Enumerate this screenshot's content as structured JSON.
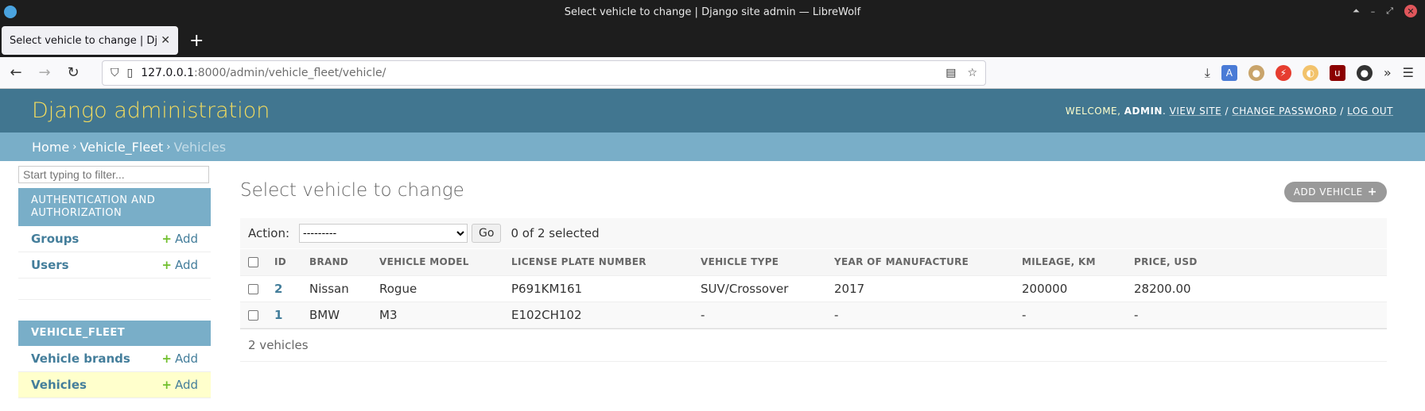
{
  "browser": {
    "window_title": "Select vehicle to change | Django site admin — LibreWolf",
    "tab_title": "Select vehicle to change | Django site admin",
    "url_host": "127.0.0.1",
    "url_path": ":8000/admin/vehicle_fleet/vehicle/"
  },
  "header": {
    "branding": "Django administration",
    "welcome": "WELCOME, ",
    "username": "ADMIN",
    "view_site": "VIEW SITE",
    "change_password": "CHANGE PASSWORD",
    "log_out": "LOG OUT"
  },
  "breadcrumbs": {
    "home": "Home",
    "app": "Vehicle_Fleet",
    "current": "Vehicles"
  },
  "sidebar": {
    "filter_placeholder": "Start typing to filter...",
    "modules": [
      {
        "caption": "AUTHENTICATION AND AUTHORIZATION",
        "items": [
          {
            "name": "Groups",
            "add": "Add"
          },
          {
            "name": "Users",
            "add": "Add"
          }
        ]
      },
      {
        "caption": "VEHICLE_FLEET",
        "items": [
          {
            "name": "Vehicle brands",
            "add": "Add"
          },
          {
            "name": "Vehicles",
            "add": "Add"
          }
        ]
      }
    ]
  },
  "content": {
    "title": "Select vehicle to change",
    "add_button": "ADD VEHICLE",
    "action_label": "Action:",
    "action_selected": "---------",
    "go": "Go",
    "counter": "0 of 2 selected",
    "columns": [
      "ID",
      "BRAND",
      "VEHICLE MODEL",
      "LICENSE PLATE NUMBER",
      "VEHICLE TYPE",
      "YEAR OF MANUFACTURE",
      "MILEAGE, KM",
      "PRICE, USD"
    ],
    "rows": [
      {
        "id": "2",
        "brand": "Nissan",
        "model": "Rogue",
        "plate": "P691KM161",
        "type": "SUV/Crossover",
        "year": "2017",
        "mileage": "200000",
        "price": "28200.00"
      },
      {
        "id": "1",
        "brand": "BMW",
        "model": "M3",
        "plate": "E102CH102",
        "type": "-",
        "year": "-",
        "mileage": "-",
        "price": "-"
      }
    ],
    "paginator": "2 vehicles"
  },
  "colors": {
    "header_bg": "#417690",
    "branding": "#f5dd5d",
    "breadcrumbs_bg": "#79aec8",
    "link": "#447e9b",
    "add_green": "#70bf2b",
    "current_row_bg": "#ffffcc"
  }
}
